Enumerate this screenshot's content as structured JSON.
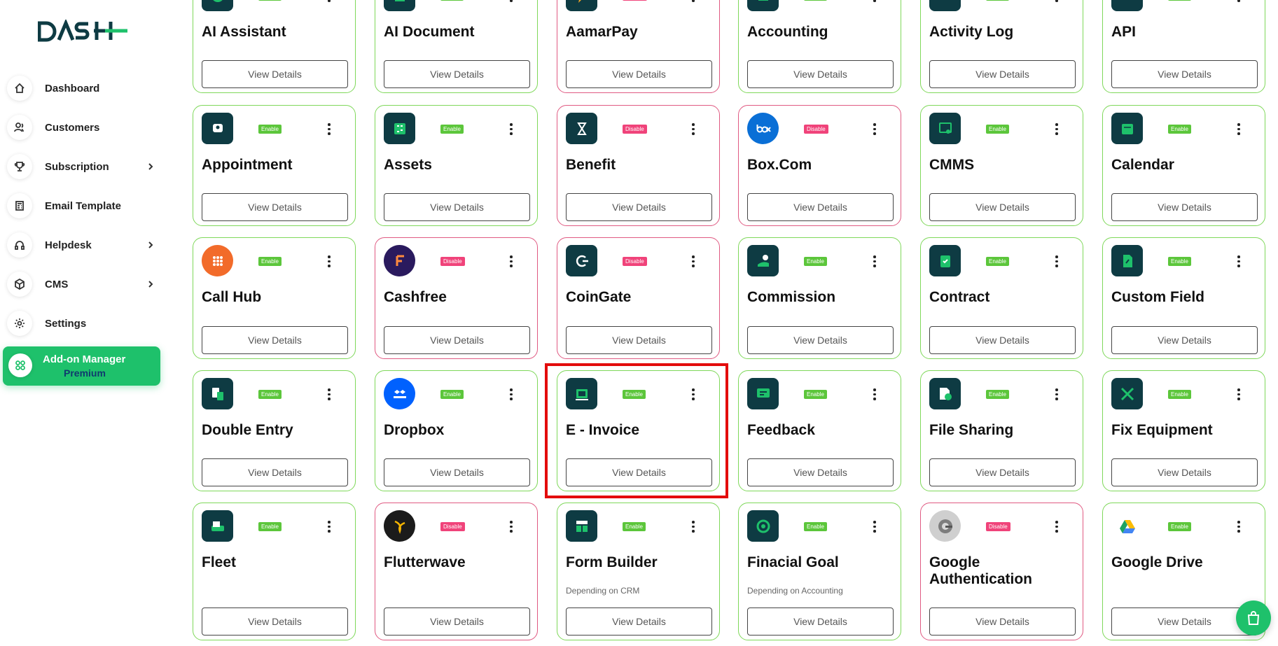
{
  "brand": {
    "logo_text": "DASH",
    "accent": "#1ec16b",
    "enabled_color": "#5cc63b",
    "disabled_color": "#f0437a"
  },
  "sidebar": {
    "items": [
      {
        "label": "Dashboard",
        "icon": "home-icon"
      },
      {
        "label": "Customers",
        "icon": "users-icon"
      },
      {
        "label": "Subscription",
        "icon": "trophy-icon",
        "chevron": true
      },
      {
        "label": "Email Template",
        "icon": "template-icon"
      },
      {
        "label": "Helpdesk",
        "icon": "headset-icon",
        "chevron": true
      },
      {
        "label": "CMS",
        "icon": "cube-icon",
        "chevron": true
      },
      {
        "label": "Settings",
        "icon": "gear-icon"
      }
    ],
    "active": {
      "label": "Add-on Manager",
      "sub": "Premium",
      "icon": "grid-icon"
    }
  },
  "button_label": "View Details",
  "cards": [
    {
      "title": "AI Assistant",
      "status": "Enable"
    },
    {
      "title": "AI Document",
      "status": "Enable"
    },
    {
      "title": "AamarPay",
      "status": "Disable"
    },
    {
      "title": "Accounting",
      "status": "Enable"
    },
    {
      "title": "Activity Log",
      "status": "Enable"
    },
    {
      "title": "API",
      "status": "Enable"
    },
    {
      "title": "Appointment",
      "status": "Enable"
    },
    {
      "title": "Assets",
      "status": "Enable"
    },
    {
      "title": "Benefit",
      "status": "Disable"
    },
    {
      "title": "Box.Com",
      "status": "Disable"
    },
    {
      "title": "CMMS",
      "status": "Enable"
    },
    {
      "title": "Calendar",
      "status": "Enable"
    },
    {
      "title": "Call Hub",
      "status": "Enable"
    },
    {
      "title": "Cashfree",
      "status": "Disable"
    },
    {
      "title": "CoinGate",
      "status": "Disable"
    },
    {
      "title": "Commission",
      "status": "Enable"
    },
    {
      "title": "Contract",
      "status": "Enable"
    },
    {
      "title": "Custom Field",
      "status": "Enable"
    },
    {
      "title": "Double Entry",
      "status": "Enable"
    },
    {
      "title": "Dropbox",
      "status": "Enable"
    },
    {
      "title": "E - Invoice",
      "status": "Enable"
    },
    {
      "title": "Feedback",
      "status": "Enable"
    },
    {
      "title": "File Sharing",
      "status": "Enable"
    },
    {
      "title": "Fix Equipment",
      "status": "Enable"
    },
    {
      "title": "Fleet",
      "status": "Enable"
    },
    {
      "title": "Flutterwave",
      "status": "Disable"
    },
    {
      "title": "Form Builder",
      "status": "Enable",
      "sub": "Depending on CRM"
    },
    {
      "title": "Finacial Goal",
      "status": "Enable",
      "sub": "Depending on Accounting"
    },
    {
      "title": "Google Authentication",
      "status": "Disable"
    },
    {
      "title": "Google Drive",
      "status": "Enable"
    }
  ]
}
